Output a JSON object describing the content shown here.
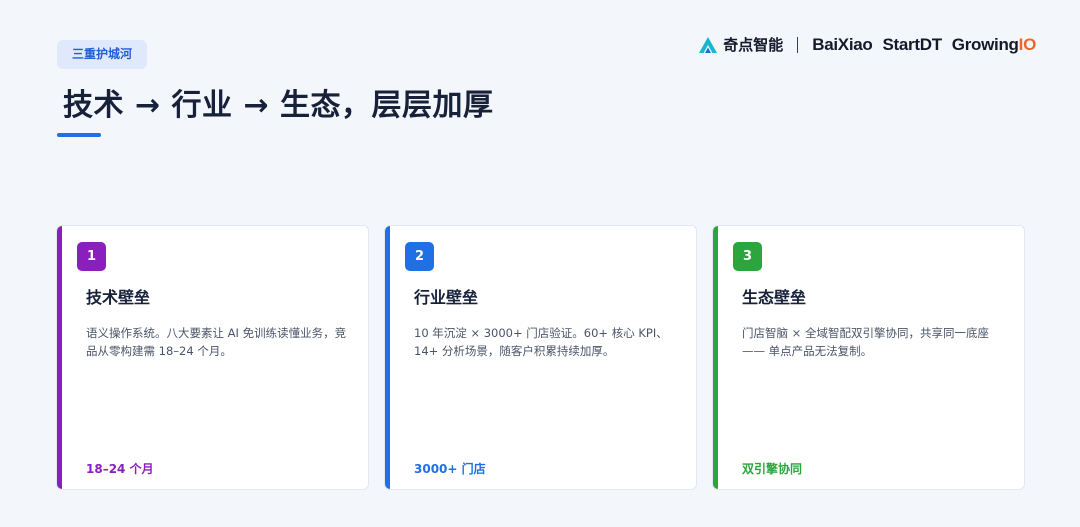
{
  "tag": "三重护城河",
  "title": "技术 → 行业 → 生态，层层加厚",
  "logos": {
    "qidian": "奇点智能",
    "baixiao": "BaiXiao",
    "startdt": "StartDT",
    "growing_main": "Growing",
    "growing_io": "IO"
  },
  "colors": {
    "purple": "#8a1fbd",
    "blue": "#1f6fe5",
    "green": "#2aa63d"
  },
  "cards": [
    {
      "number": "1",
      "title": "技术壁垒",
      "description": "语义操作系统。八大要素让 AI 免训练读懂业务，竞品从零构建需 18–24 个月。",
      "footer": "18–24 个月"
    },
    {
      "number": "2",
      "title": "行业壁垒",
      "description": "10 年沉淀 × 3000+ 门店验证。60+ 核心 KPI、14+ 分析场景，随客户积累持续加厚。",
      "footer": "3000+ 门店"
    },
    {
      "number": "3",
      "title": "生态壁垒",
      "description": "门店智脑 × 全域智配双引擎协同，共享同一底座 —— 单点产品无法复制。",
      "footer": "双引擎协同"
    }
  ]
}
